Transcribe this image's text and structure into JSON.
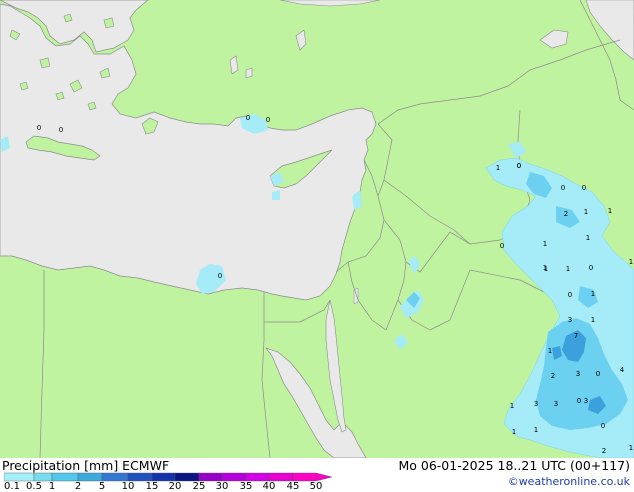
{
  "title": "Precipitation [mm]  ECMWF",
  "datetime": "Mo 06-01-2025 18..21 UTC (00+117)",
  "credit": "©weatheronline.co.uk",
  "scale": {
    "labels": [
      "0.1",
      "0.5",
      "1",
      "2",
      "5",
      "10",
      "15",
      "20",
      "25",
      "30",
      "35",
      "40",
      "45",
      "50"
    ],
    "colors": [
      "#ffffff",
      "#a4f0fa",
      "#78dcf0",
      "#50c8eb",
      "#3caadc",
      "#3278d2",
      "#1e50be",
      "#1432aa",
      "#0a1482",
      "#9600c8",
      "#b400dc",
      "#d200e6",
      "#e600d2",
      "#ff00c8"
    ]
  },
  "colors": {
    "sea": "#e9e9e9",
    "land": "#bff3a0",
    "border": "#8c8c8c",
    "precip_light": "#a6ecf8",
    "precip_mid": "#6cd0f0",
    "precip_heavy": "#3ca0dc"
  },
  "map_values": [
    "0",
    "0",
    "0",
    "0",
    "1",
    "0",
    "0",
    "0",
    "0",
    "2",
    "1",
    "1",
    "0",
    "1",
    "1",
    "1",
    "1",
    "0",
    "1",
    "1",
    "3",
    "7",
    "1",
    "1",
    "3",
    "0",
    "2",
    "3",
    "4",
    "1",
    "3",
    "3",
    "0",
    "1",
    "1",
    "0",
    "2",
    "1",
    "0",
    "0",
    "1"
  ]
}
